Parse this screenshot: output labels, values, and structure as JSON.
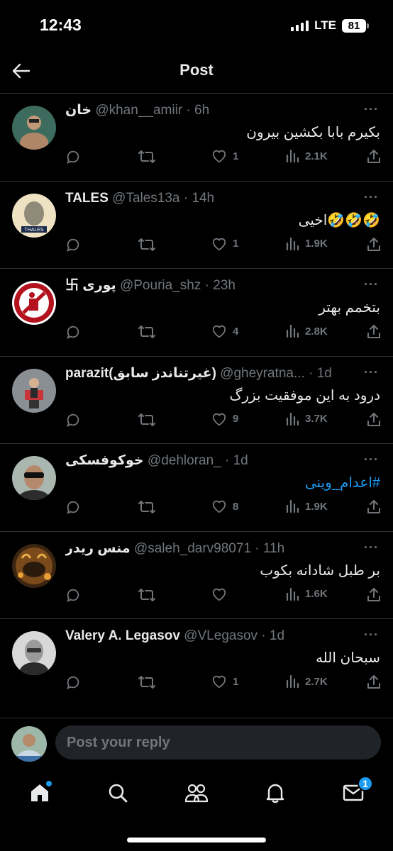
{
  "status_bar": {
    "time": "12:43",
    "network": "LTE",
    "battery": "81"
  },
  "header": {
    "title": "Post",
    "back_icon": "arrow-left-icon"
  },
  "replies": [
    {
      "name": "خان",
      "handle": "@khan__amiir",
      "time": "· 6h",
      "text": "بکیرم بابا بکشین بیرون",
      "hashtag": false,
      "likes": "1",
      "views": "2.1K"
    },
    {
      "name": "TALES",
      "handle": "@Tales13a",
      "time": "· 14h",
      "text": "🤣🤣🤣اخیی",
      "hashtag": false,
      "likes": "1",
      "views": "1.9K"
    },
    {
      "name": "卐 پوری",
      "handle": "@Pouria_shz",
      "time": "· 23h",
      "text": "بتخمم بهتر",
      "hashtag": false,
      "likes": "4",
      "views": "2.8K"
    },
    {
      "name": "parazit(غیرتناندز سابق)",
      "handle": "@gheyratna...",
      "time": "· 1d",
      "text": "درود به این موفقیت بزرگ",
      "hashtag": false,
      "likes": "9",
      "views": "3.7K"
    },
    {
      "name": "خوکوفسکی",
      "handle": "@dehloran_",
      "time": "· 1d",
      "text": "#اعدام_وینی",
      "hashtag": true,
      "likes": "8",
      "views": "1.9K"
    },
    {
      "name": "منس ریدر",
      "handle": "@saleh_darv98071",
      "time": "· 11h",
      "text": "بر طبل شادانه بکوب",
      "hashtag": false,
      "likes": "",
      "views": "1.6K"
    },
    {
      "name": "Valery A. Legasov",
      "handle": "@VLegasov",
      "time": "· 1d",
      "text": "سبحان الله",
      "hashtag": false,
      "likes": "1",
      "views": "2.7K"
    }
  ],
  "composer": {
    "placeholder": "Post your reply"
  },
  "nav": {
    "messages_badge": "1",
    "items": [
      "home-icon",
      "search-icon",
      "communities-icon",
      "notifications-icon",
      "messages-icon"
    ]
  },
  "colors": {
    "accent": "#1d9bf0",
    "muted": "#71767b",
    "background": "#000000",
    "divider": "#2f3336"
  }
}
